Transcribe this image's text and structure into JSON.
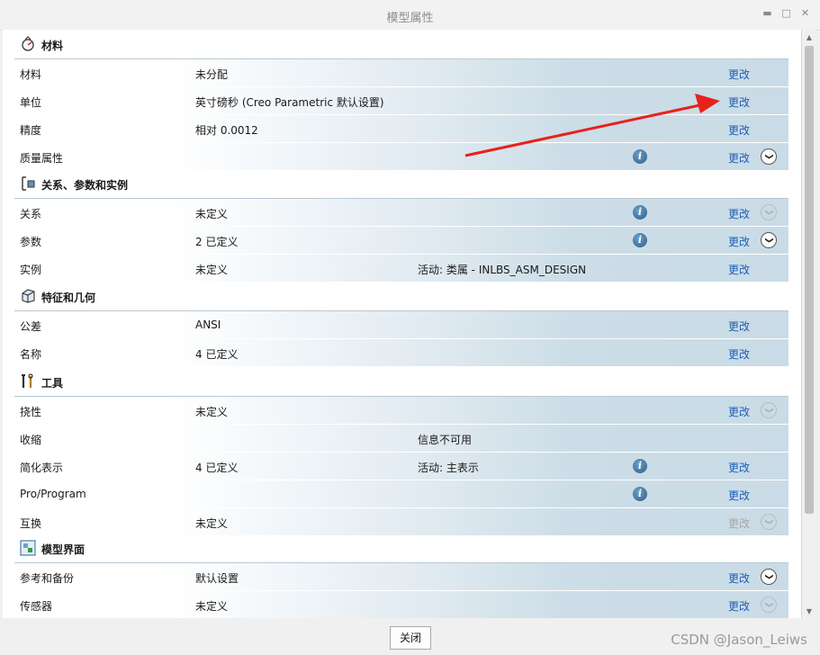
{
  "window": {
    "title": "模型属性"
  },
  "sections": [
    {
      "title": "材料",
      "icon": "material-icon",
      "rows": [
        {
          "label": "材料",
          "value": "未分配",
          "extra": "",
          "info": false,
          "change": "更改",
          "change_disabled": false,
          "expand": "none"
        },
        {
          "label": "单位",
          "value": "英寸磅秒 (Creo Parametric 默认设置)",
          "extra": "",
          "info": false,
          "change": "更改",
          "change_disabled": false,
          "expand": "none"
        },
        {
          "label": "精度",
          "value": "相对 0.0012",
          "extra": "",
          "info": false,
          "change": "更改",
          "change_disabled": false,
          "expand": "none"
        },
        {
          "label": "质量属性",
          "value": "",
          "extra": "",
          "info": true,
          "change": "更改",
          "change_disabled": false,
          "expand": "active"
        }
      ]
    },
    {
      "title": "关系、参数和实例",
      "icon": "relations-icon",
      "rows": [
        {
          "label": "关系",
          "value": "未定义",
          "extra": "",
          "info": true,
          "change": "更改",
          "change_disabled": false,
          "expand": "dim"
        },
        {
          "label": "参数",
          "value": "2 已定义",
          "extra": "",
          "info": true,
          "change": "更改",
          "change_disabled": false,
          "expand": "active"
        },
        {
          "label": "实例",
          "value": "未定义",
          "extra": "活动: 类属 - INLBS_ASM_DESIGN",
          "info": false,
          "change": "更改",
          "change_disabled": false,
          "expand": "none"
        }
      ]
    },
    {
      "title": "特征和几何",
      "icon": "feature-geometry-icon",
      "rows": [
        {
          "label": "公差",
          "value": "ANSI",
          "extra": "",
          "info": false,
          "change": "更改",
          "change_disabled": false,
          "expand": "none"
        },
        {
          "label": "名称",
          "value": "4 已定义",
          "extra": "",
          "info": false,
          "change": "更改",
          "change_disabled": false,
          "expand": "none"
        }
      ]
    },
    {
      "title": "工具",
      "icon": "tools-icon",
      "rows": [
        {
          "label": "挠性",
          "value": "未定义",
          "extra": "",
          "info": false,
          "change": "更改",
          "change_disabled": false,
          "expand": "dim"
        },
        {
          "label": "收缩",
          "value": "",
          "extra": "信息不可用",
          "info": false,
          "change": "",
          "change_disabled": false,
          "expand": "none"
        },
        {
          "label": "简化表示",
          "value": "4 已定义",
          "extra": "活动: 主表示",
          "info": true,
          "change": "更改",
          "change_disabled": false,
          "expand": "none"
        },
        {
          "label": "Pro/Program",
          "value": "",
          "extra": "",
          "info": true,
          "change": "更改",
          "change_disabled": false,
          "expand": "none"
        },
        {
          "label": "互换",
          "value": "未定义",
          "extra": "",
          "info": false,
          "change": "更改",
          "change_disabled": true,
          "expand": "dim"
        }
      ]
    },
    {
      "title": "模型界面",
      "icon": "model-interface-icon",
      "rows": [
        {
          "label": "参考和备份",
          "value": "默认设置",
          "extra": "",
          "info": false,
          "change": "更改",
          "change_disabled": false,
          "expand": "active"
        },
        {
          "label": "传感器",
          "value": "未定义",
          "extra": "",
          "info": false,
          "change": "更改",
          "change_disabled": false,
          "expand": "dim"
        }
      ]
    }
  ],
  "footer": {
    "close_label": "关闭"
  },
  "watermark": "CSDN @Jason_Leiws",
  "colors": {
    "link": "#1f5fb5",
    "annotation_arrow": "#e8211c"
  }
}
